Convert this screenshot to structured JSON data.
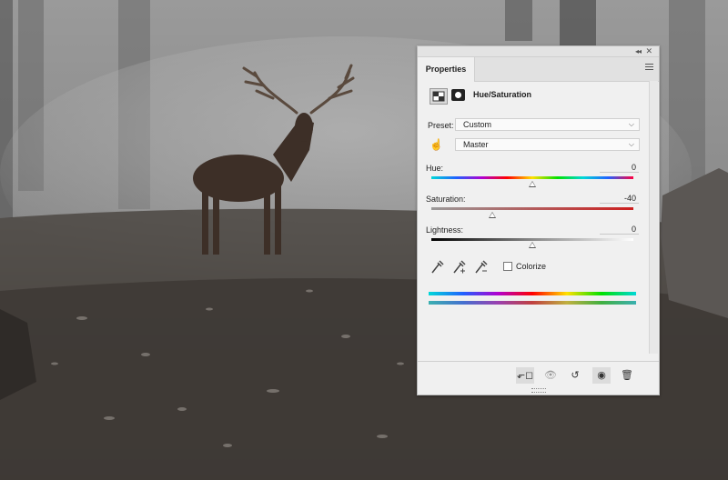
{
  "panel": {
    "tab_label": "Properties",
    "title": "Hue/Saturation",
    "preset_label": "Preset:",
    "preset_value": "Custom",
    "channel_value": "Master",
    "hue_label": "Hue:",
    "hue_value": "0",
    "saturation_label": "Saturation:",
    "saturation_value": "-40",
    "lightness_label": "Lightness:",
    "lightness_value": "0",
    "colorize_label": "Colorize",
    "colorize_checked": false
  },
  "icons": {
    "collapse": "double-chevron-left-icon",
    "close": "close-icon",
    "menu": "hamburger-menu-icon",
    "adjustment_layer": "adjustment-layer-icon",
    "mask": "layer-mask-icon",
    "targeted_adjustment": "hand-adjust-icon",
    "eyedropper": "eyedropper-icon",
    "add_eyedropper": "eyedropper-plus-icon",
    "subtract_eyedropper": "eyedropper-minus-icon",
    "clip": "clip-to-layer-icon",
    "view_previous": "view-previous-icon",
    "reset": "reset-icon",
    "visibility": "eye-icon",
    "delete": "trash-icon"
  },
  "colors": {
    "panel_bg": "#f0f0f0",
    "hue_spectrum": "rainbow",
    "saturation_bar_end": "#cc1e1e"
  }
}
